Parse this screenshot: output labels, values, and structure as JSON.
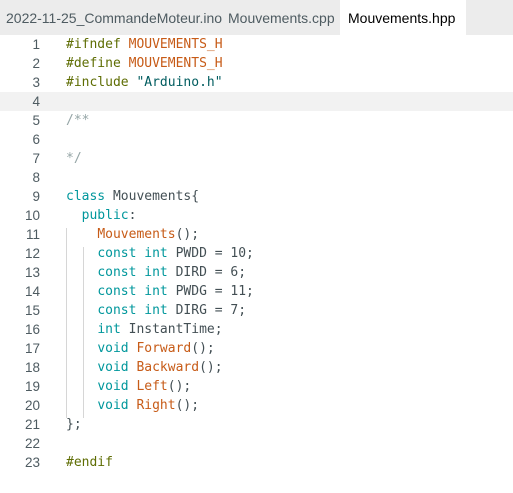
{
  "tabs": [
    {
      "label": "2022-11-25_CommandeMoteur.ino",
      "active": false
    },
    {
      "label": "Mouvements.cpp",
      "active": false
    },
    {
      "label": "Mouvements.hpp",
      "active": true
    }
  ],
  "editor": {
    "current_line": 4,
    "colors": {
      "keyword": "#00979c",
      "preprocessor": "#5e6d03",
      "macro": "#c75b17",
      "string": "#005c5f",
      "comment": "#95a5a6",
      "function": "#c75b17",
      "plain": "#434f54"
    },
    "lines": [
      {
        "n": "1",
        "tokens": [
          {
            "t": "#ifndef ",
            "c": "pp"
          },
          {
            "t": "MOUVEMENTS_H",
            "c": "macro"
          }
        ]
      },
      {
        "n": "2",
        "tokens": [
          {
            "t": "#define ",
            "c": "pp"
          },
          {
            "t": "MOUVEMENTS_H",
            "c": "macro"
          }
        ]
      },
      {
        "n": "3",
        "tokens": [
          {
            "t": "#include ",
            "c": "pp"
          },
          {
            "t": "\"Arduino.h\"",
            "c": "str"
          }
        ]
      },
      {
        "n": "4",
        "tokens": []
      },
      {
        "n": "5",
        "tokens": [
          {
            "t": "/**",
            "c": "cmt"
          }
        ]
      },
      {
        "n": "6",
        "tokens": []
      },
      {
        "n": "7",
        "tokens": [
          {
            "t": "*/",
            "c": "cmt"
          }
        ]
      },
      {
        "n": "8",
        "tokens": []
      },
      {
        "n": "9",
        "tokens": [
          {
            "t": "class",
            "c": "kw"
          },
          {
            "t": " Mouvements{",
            "c": "plain"
          }
        ]
      },
      {
        "n": "10",
        "tokens": [
          {
            "t": "  ",
            "c": "plain"
          },
          {
            "t": "public",
            "c": "kw"
          },
          {
            "t": ":",
            "c": "plain"
          }
        ]
      },
      {
        "n": "11",
        "tokens": [
          {
            "t": "    ",
            "c": "plain"
          },
          {
            "t": "Mouvements",
            "c": "fn"
          },
          {
            "t": "();",
            "c": "plain"
          }
        ]
      },
      {
        "n": "12",
        "tokens": [
          {
            "t": "    ",
            "c": "plain"
          },
          {
            "t": "const",
            "c": "kw"
          },
          {
            "t": " ",
            "c": "plain"
          },
          {
            "t": "int",
            "c": "kw"
          },
          {
            "t": " PWDD = 10;",
            "c": "plain"
          }
        ]
      },
      {
        "n": "13",
        "tokens": [
          {
            "t": "    ",
            "c": "plain"
          },
          {
            "t": "const",
            "c": "kw"
          },
          {
            "t": " ",
            "c": "plain"
          },
          {
            "t": "int",
            "c": "kw"
          },
          {
            "t": " DIRD = 6;",
            "c": "plain"
          }
        ]
      },
      {
        "n": "14",
        "tokens": [
          {
            "t": "    ",
            "c": "plain"
          },
          {
            "t": "const",
            "c": "kw"
          },
          {
            "t": " ",
            "c": "plain"
          },
          {
            "t": "int",
            "c": "kw"
          },
          {
            "t": " PWDG = 11;",
            "c": "plain"
          }
        ]
      },
      {
        "n": "15",
        "tokens": [
          {
            "t": "    ",
            "c": "plain"
          },
          {
            "t": "const",
            "c": "kw"
          },
          {
            "t": " ",
            "c": "plain"
          },
          {
            "t": "int",
            "c": "kw"
          },
          {
            "t": " DIRG = 7;",
            "c": "plain"
          }
        ]
      },
      {
        "n": "16",
        "tokens": [
          {
            "t": "    ",
            "c": "plain"
          },
          {
            "t": "int",
            "c": "kw"
          },
          {
            "t": " InstantTime;",
            "c": "plain"
          }
        ]
      },
      {
        "n": "17",
        "tokens": [
          {
            "t": "    ",
            "c": "plain"
          },
          {
            "t": "void",
            "c": "kw"
          },
          {
            "t": " ",
            "c": "plain"
          },
          {
            "t": "Forward",
            "c": "fn"
          },
          {
            "t": "();",
            "c": "plain"
          }
        ]
      },
      {
        "n": "18",
        "tokens": [
          {
            "t": "    ",
            "c": "plain"
          },
          {
            "t": "void",
            "c": "kw"
          },
          {
            "t": " ",
            "c": "plain"
          },
          {
            "t": "Backward",
            "c": "fn"
          },
          {
            "t": "();",
            "c": "plain"
          }
        ]
      },
      {
        "n": "19",
        "tokens": [
          {
            "t": "    ",
            "c": "plain"
          },
          {
            "t": "void",
            "c": "kw"
          },
          {
            "t": " ",
            "c": "plain"
          },
          {
            "t": "Left",
            "c": "fn"
          },
          {
            "t": "();",
            "c": "plain"
          }
        ]
      },
      {
        "n": "20",
        "tokens": [
          {
            "t": "    ",
            "c": "plain"
          },
          {
            "t": "void",
            "c": "kw"
          },
          {
            "t": " ",
            "c": "plain"
          },
          {
            "t": "Right",
            "c": "fn"
          },
          {
            "t": "();",
            "c": "plain"
          }
        ]
      },
      {
        "n": "21",
        "tokens": [
          {
            "t": "};",
            "c": "plain"
          }
        ]
      },
      {
        "n": "22",
        "tokens": []
      },
      {
        "n": "23",
        "tokens": [
          {
            "t": "#endif",
            "c": "pp"
          }
        ]
      }
    ]
  }
}
